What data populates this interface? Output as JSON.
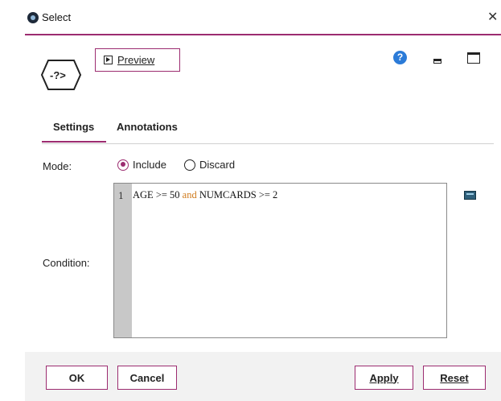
{
  "window": {
    "title": "Select"
  },
  "toolbar": {
    "preview_label": "Preview",
    "help_glyph": "?"
  },
  "tabs": [
    {
      "label": "Settings",
      "active": true
    },
    {
      "label": "Annotations",
      "active": false
    }
  ],
  "mode": {
    "label": "Mode:",
    "options": [
      {
        "label": "Include",
        "selected": true
      },
      {
        "label": "Discard",
        "selected": false
      }
    ]
  },
  "condition": {
    "label": "Condition:",
    "line_number": "1",
    "code_parts": [
      "AGE >= 50 ",
      "and",
      " NUMCARDS >= 2"
    ]
  },
  "buttons": {
    "ok": "OK",
    "cancel": "Cancel",
    "apply": "Apply",
    "reset": "Reset"
  },
  "icons": {
    "app": "select-node-app-icon",
    "node": "select-node-icon",
    "help": "help-icon",
    "minimize": "minimize-icon",
    "maximize": "maximize-icon",
    "close": "close-icon",
    "expression_builder": "expression-builder-icon"
  },
  "colors": {
    "accent": "#9c2c70",
    "keyword": "#d07a1b",
    "help": "#2b7bd8",
    "footer_bg": "#f2f2f2"
  }
}
